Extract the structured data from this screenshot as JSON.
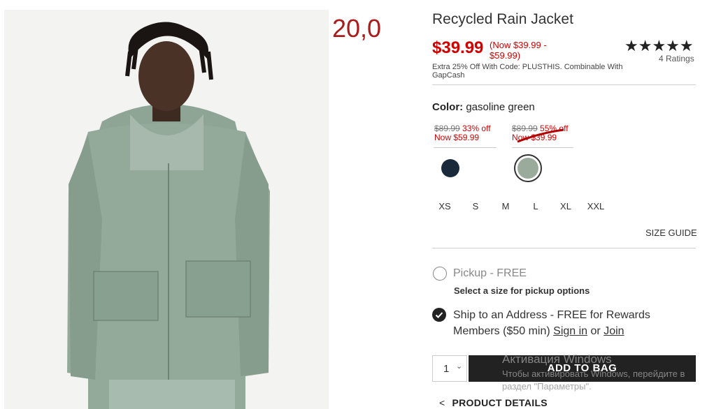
{
  "overlay": {
    "number": "20,0"
  },
  "product": {
    "title": "Recycled Rain Jacket",
    "price": "$39.99",
    "price_range": "(Now $39.99 - $59.99)",
    "promo": "Extra 25% Off With Code: PLUSTHIS. Combinable With GapCash",
    "rating_stars": "★★★★★",
    "rating_count": "4 Ratings"
  },
  "color": {
    "label": "Color:",
    "value": "gasoline green",
    "swatch_groups": [
      {
        "original": "$89.99",
        "discount": "33% off",
        "now": "Now $59.99"
      },
      {
        "original": "$89.99",
        "discount": "55% off",
        "now": "Now $39.99"
      }
    ],
    "swatches": [
      {
        "name": "navy",
        "color": "#1b2a3a"
      },
      {
        "name": "gasoline green",
        "color": "#9aab9c"
      }
    ]
  },
  "sizes": [
    "XS",
    "S",
    "M",
    "L",
    "XL",
    "XXL"
  ],
  "size_guide": "SIZE GUIDE",
  "fulfillment": {
    "pickup_label": "Pickup - FREE",
    "pickup_sub": "Select a size for pickup options",
    "ship_prefix": "Ship to an Address - FREE for Rewards Members ($50 min) ",
    "sign_in": "Sign in",
    "or": " or ",
    "join": "Join"
  },
  "cart": {
    "quantity": "1",
    "add_label": "ADD TO BAG"
  },
  "details_label": "PRODUCT DETAILS",
  "watermark": {
    "title": "Активация Windows",
    "line": "Чтобы активировать Windows, перейдите в раздел \"Параметры\"."
  },
  "colors": {
    "sale_red": "#d00000",
    "accent_dark": "#222222"
  }
}
